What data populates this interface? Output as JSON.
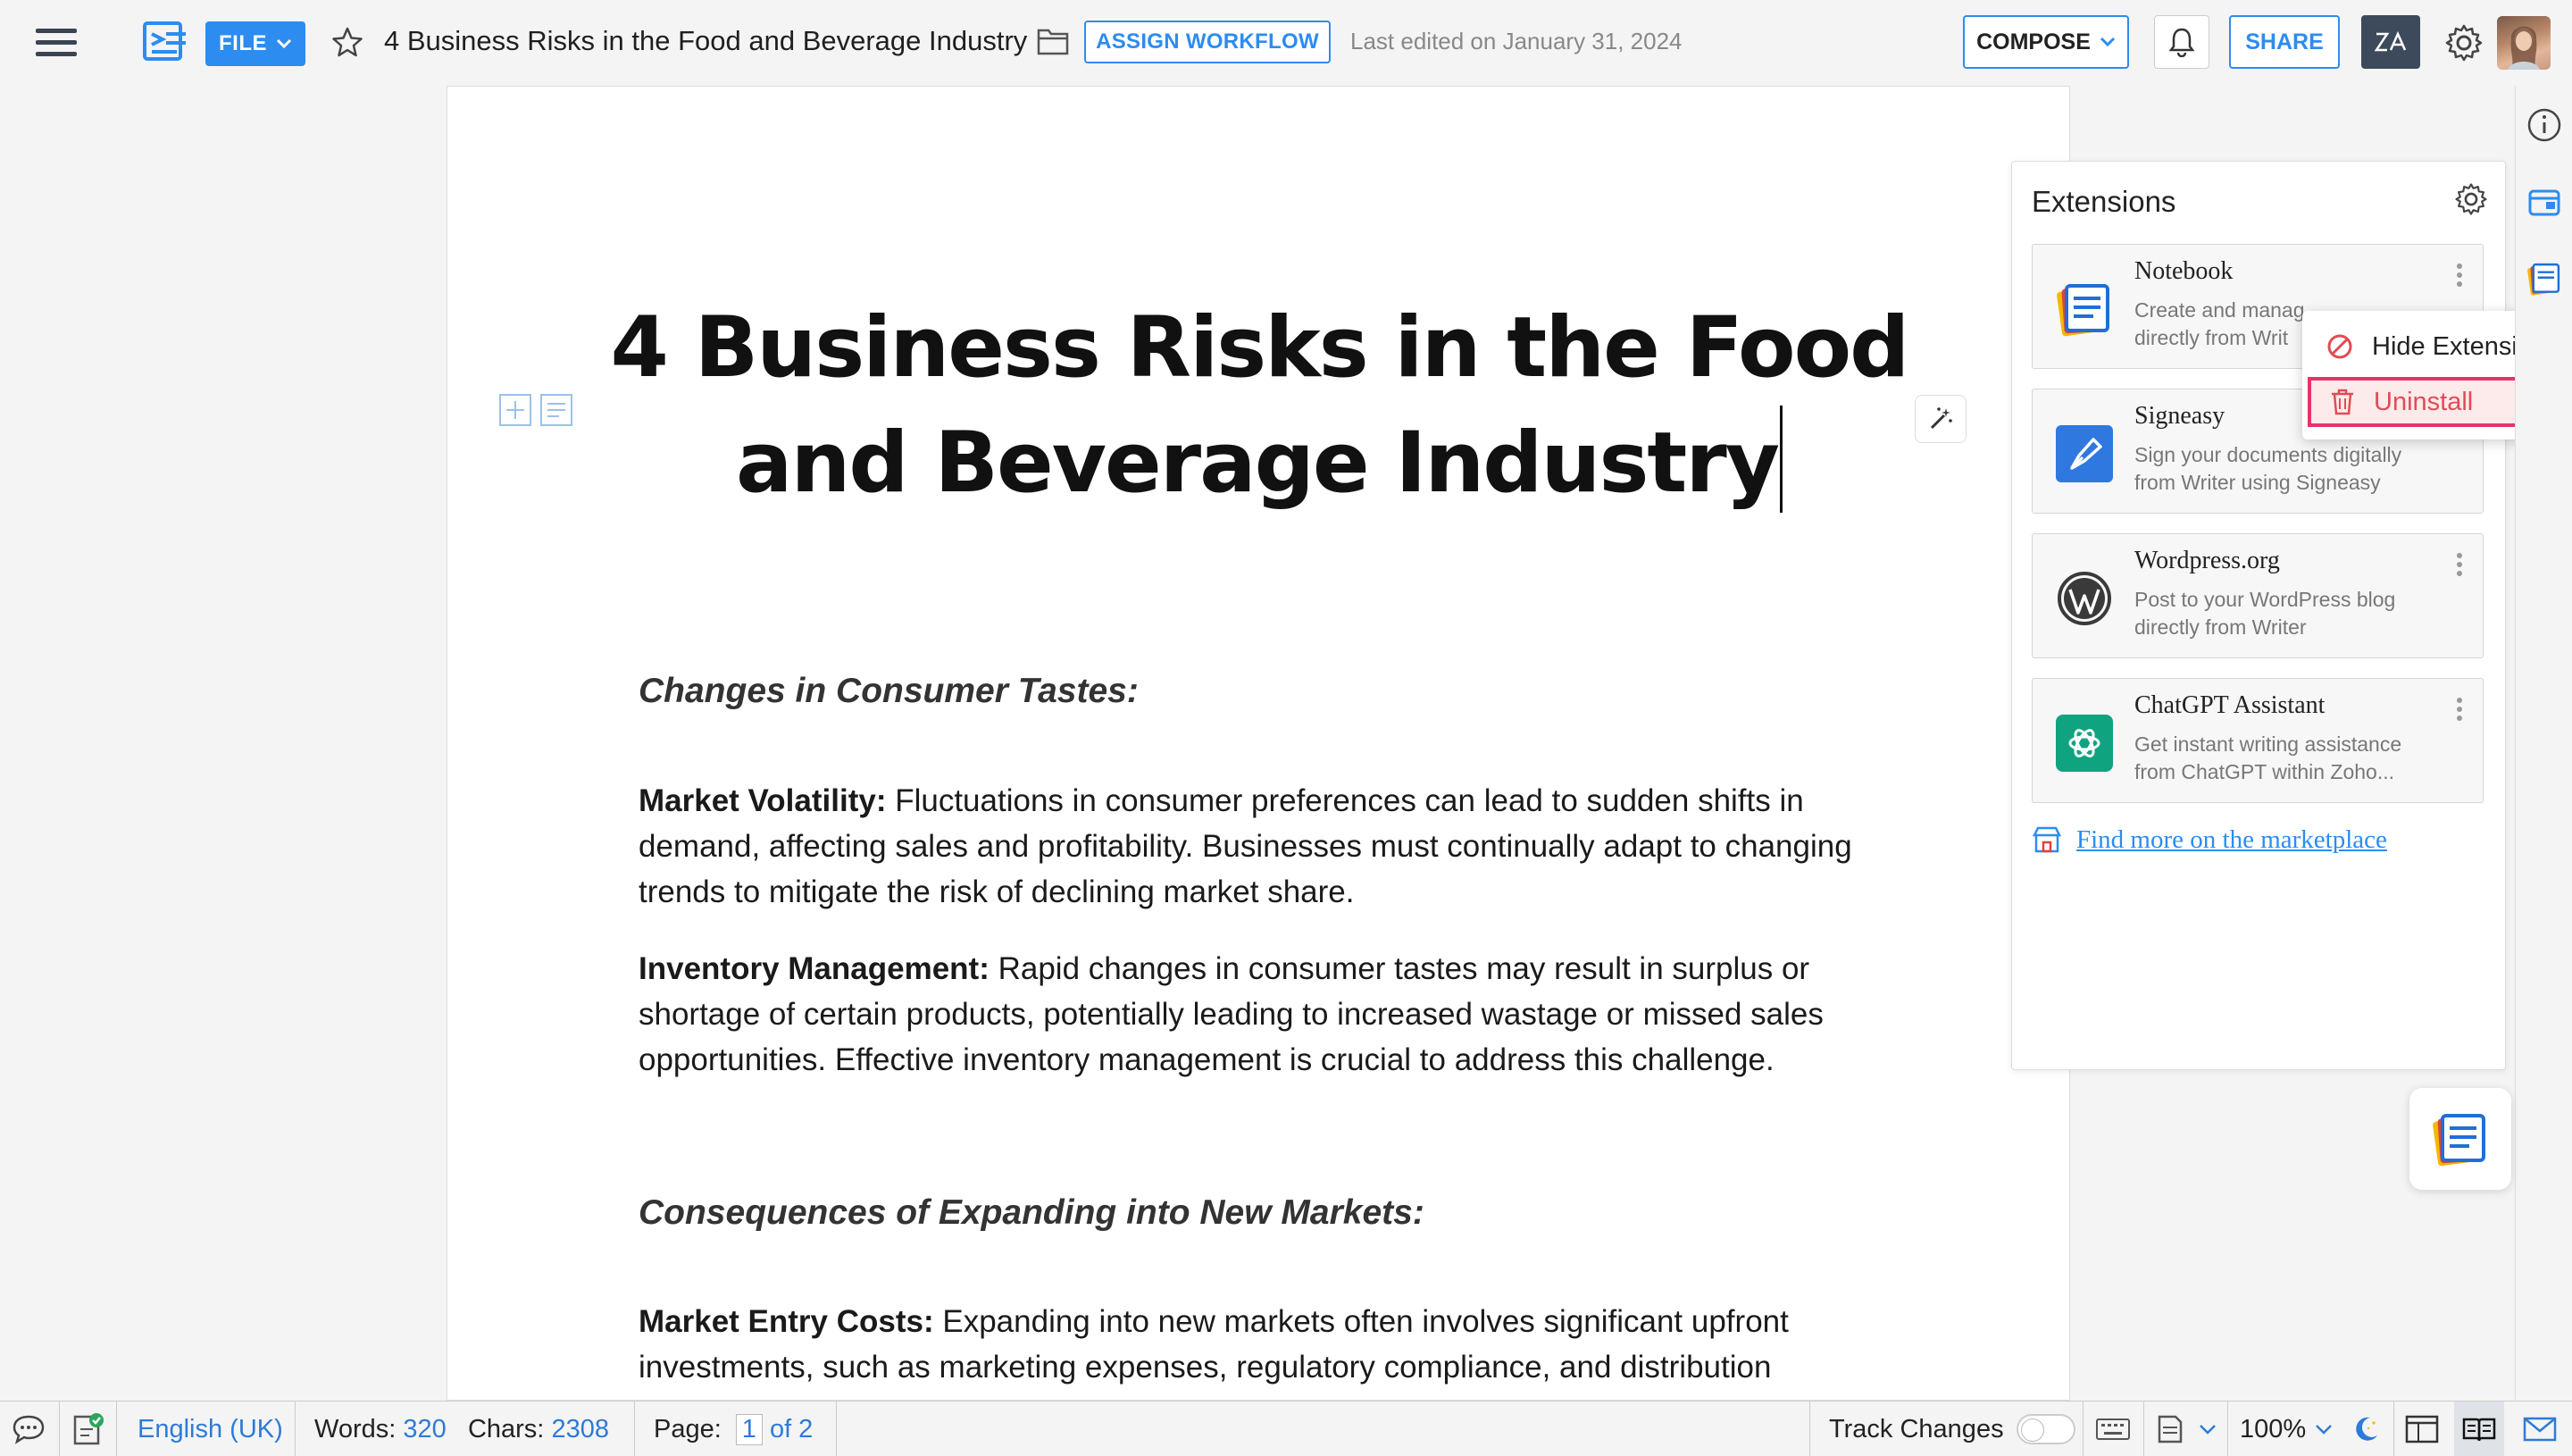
{
  "topbar": {
    "file_label": "FILE",
    "doc_title": "4 Business Risks in the Food and Beverage Industry",
    "assign_workflow_label": "ASSIGN WORKFLOW",
    "last_edited": "Last edited on January 31, 2024",
    "compose_label": "COMPOSE",
    "share_label": "SHARE"
  },
  "document": {
    "title_line1": "4 Business Risks in the Food",
    "title_line2": "and Beverage Industry",
    "sections": [
      {
        "heading": "Changes in Consumer Tastes:",
        "paragraphs": [
          {
            "lead": "Market Volatility:",
            "text": " Fluctuations in consumer preferences can lead to sudden shifts in demand, affecting sales and profitability. Businesses must continually adapt to changing trends to mitigate the risk of declining market share."
          },
          {
            "lead": "Inventory Management:",
            "text": " Rapid changes in consumer tastes may result in surplus or shortage of certain products, potentially leading to increased wastage or missed sales opportunities. Effective inventory management is crucial to address this challenge."
          }
        ]
      },
      {
        "heading": "Consequences of Expanding into New Markets:",
        "paragraphs": [
          {
            "lead": "Market Entry Costs:",
            "text": " Expanding into new markets often involves significant upfront investments, such as marketing expenses, regulatory compliance, and distribution"
          }
        ]
      }
    ]
  },
  "extensions": {
    "title": "Extensions",
    "items": [
      {
        "name": "Notebook",
        "desc_line1": "Create and manag",
        "desc_line2": "directly from Writ",
        "icon": "notebook-icon"
      },
      {
        "name": "Signeasy",
        "desc_line1": "Sign your documents digitally",
        "desc_line2": "from Writer using Signeasy",
        "icon": "signeasy-icon"
      },
      {
        "name": "Wordpress.org",
        "desc_line1": "Post to your WordPress blog",
        "desc_line2": "directly from Writer",
        "icon": "wordpress-icon"
      },
      {
        "name": "ChatGPT Assistant",
        "desc_line1": "Get instant writing assistance",
        "desc_line2": "from ChatGPT within Zoho...",
        "icon": "chatgpt-icon"
      }
    ],
    "find_more": "Find more on the marketplace",
    "context_menu": {
      "hide_label": "Hide Extension",
      "uninstall_label": "Uninstall"
    }
  },
  "statusbar": {
    "language": "English (UK)",
    "words_label": "Words:",
    "words_value": "320",
    "chars_label": "Chars:",
    "chars_value": "2308",
    "page_label": "Page:",
    "page_current": "1",
    "page_total": "of 2",
    "track_changes": "Track Changes",
    "zoom": "100%"
  },
  "colors": {
    "accent": "#2d8cf0",
    "danger": "#e24b55",
    "highlight_border": "#e8326a"
  }
}
